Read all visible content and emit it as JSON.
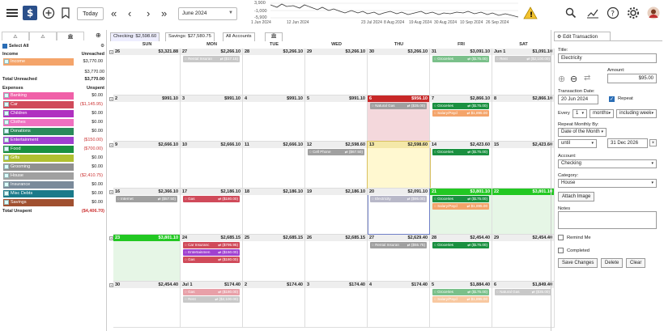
{
  "toolbar": {
    "today_label": "Today",
    "month_value": "June 2024",
    "sparkline": {
      "y_labels": [
        "3,900",
        "-1,000",
        "-5,900"
      ],
      "x_labels": [
        "1 Jun 2024",
        "12 Jun 2024",
        "23 Jul 2024",
        "8 Aug 2024",
        "19 Aug 2024",
        "30 Aug 2024",
        "10 Sep 2024",
        "26 Sep 2024"
      ]
    }
  },
  "sidebar": {
    "select_all": "Select All",
    "income_header": "Income",
    "unreached_header": "Unreached",
    "income": [
      {
        "label": "Income",
        "amount": "$3,770.00",
        "color": "#f4a46a"
      }
    ],
    "income_amount2": "$3,770.00",
    "total_unreached_label": "Total Unreached",
    "total_unreached": "$3,770.00",
    "expenses_header": "Expenses",
    "unspent_header": "Unspent",
    "expenses": [
      {
        "label": "Banking",
        "amount": "$0.00",
        "color": "#f060a8",
        "neg": false
      },
      {
        "label": "Car",
        "amount": "($1,145.95)",
        "color": "#d04a5a",
        "neg": true
      },
      {
        "label": "Children",
        "amount": "$0.00",
        "color": "#b030c0",
        "neg": false
      },
      {
        "label": "Clothes",
        "amount": "$0.00",
        "color": "#f070c0",
        "neg": false
      },
      {
        "label": "Donations",
        "amount": "$0.00",
        "color": "#2a8a5a",
        "neg": false
      },
      {
        "label": "Entertainment",
        "amount": "($150.00)",
        "color": "#a040d0",
        "neg": true
      },
      {
        "label": "Food",
        "amount": "($700.00)",
        "color": "#1a9040",
        "neg": true
      },
      {
        "label": "Gifts",
        "amount": "$0.00",
        "color": "#b0c030",
        "neg": false
      },
      {
        "label": "Grooming",
        "amount": "$0.00",
        "color": "#909090",
        "neg": false
      },
      {
        "label": "House",
        "amount": "($2,410.75)",
        "color": "#a0a0a0",
        "neg": true
      },
      {
        "label": "Insurance",
        "amount": "$0.00",
        "color": "#7a8a9a",
        "neg": false
      },
      {
        "label": "Misc Debts",
        "amount": "$0.00",
        "color": "#1a7a8a",
        "neg": false
      },
      {
        "label": "Savings",
        "amount": "$0.00",
        "color": "#a05030",
        "neg": false
      }
    ],
    "total_unspent_label": "Total Unspent",
    "total_unspent": "($4,406.70)"
  },
  "main": {
    "tabs": [
      "Checking: $2,598.60",
      "Savings: $27,580.75",
      "All Accounts"
    ],
    "days": [
      "SUN",
      "MON",
      "TUE",
      "WED",
      "THU",
      "FRI",
      "SAT"
    ],
    "weeks": [
      [
        {
          "d": "26",
          "bal": "$3,321.88",
          "ev": []
        },
        {
          "d": "27",
          "bal": "$2,266.10",
          "ev": [
            {
              "t": "Rental Insuran",
              "a": "⇄ ($17.15)",
              "c": "#c8c8c8"
            }
          ]
        },
        {
          "d": "28",
          "bal": "$3,266.10",
          "ev": []
        },
        {
          "d": "29",
          "bal": "$3,266.10",
          "ev": []
        },
        {
          "d": "30",
          "bal": "$3,266.10",
          "ev": []
        },
        {
          "d": "31",
          "bal": "$3,091.10",
          "ev": [
            {
              "t": "Groceries",
              "a": "⇄ ($175.00)",
              "c": "#7ac08a"
            }
          ]
        },
        {
          "d": "Jun 1",
          "bal": "$1,091.10",
          "ev": [
            {
              "t": "Rent",
              "a": "⇄ ($2,100.00)",
              "c": "#c8c8c8"
            }
          ]
        }
      ],
      [
        {
          "d": "2",
          "bal": "$991.10",
          "ev": []
        },
        {
          "d": "3",
          "bal": "$991.10",
          "ev": []
        },
        {
          "d": "4",
          "bal": "$991.10",
          "ev": []
        },
        {
          "d": "5",
          "bal": "$991.10",
          "ev": []
        },
        {
          "d": "6",
          "bal": "$956.10",
          "ev": [
            {
              "t": "Natural Gas",
              "a": "⇄ ($35.00)",
              "c": "#a0a0a0"
            }
          ],
          "red": true
        },
        {
          "d": "7",
          "bal": "$2,866.10",
          "ev": [
            {
              "t": "Groceries",
              "a": "⇄ ($175.00)",
              "c": "#1a9040"
            },
            {
              "t": "Salary/Payd",
              "a": "⇄ $1,895.00",
              "c": "#f4a46a"
            }
          ]
        },
        {
          "d": "8",
          "bal": "$2,866.10",
          "ev": []
        }
      ],
      [
        {
          "d": "9",
          "bal": "$2,666.10",
          "ev": []
        },
        {
          "d": "10",
          "bal": "$2,666.10",
          "ev": []
        },
        {
          "d": "11",
          "bal": "$2,666.10",
          "ev": []
        },
        {
          "d": "12",
          "bal": "$2,598.60",
          "ev": [
            {
              "t": "Cell Phone",
              "a": "⇄ ($67.50)",
              "c": "#a0a0a0"
            }
          ]
        },
        {
          "d": "13",
          "bal": "$2,598.60",
          "ev": [],
          "today": true
        },
        {
          "d": "14",
          "bal": "$2,423.60",
          "ev": [
            {
              "t": "Groceries",
              "a": "⇄ ($175.00)",
              "c": "#1a9040"
            }
          ]
        },
        {
          "d": "15",
          "bal": "$2,423.60",
          "ev": []
        }
      ],
      [
        {
          "d": "16",
          "bal": "$2,366.10",
          "ev": [
            {
              "t": "Internet",
              "a": "⇄ ($57.50)",
              "c": "#a0a0a0"
            }
          ]
        },
        {
          "d": "17",
          "bal": "$2,186.10",
          "ev": [
            {
              "t": "Gas",
              "a": "⇄ ($180.00)",
              "c": "#d04a5a"
            }
          ]
        },
        {
          "d": "18",
          "bal": "$2,186.10",
          "ev": []
        },
        {
          "d": "19",
          "bal": "$2,186.10",
          "ev": []
        },
        {
          "d": "20",
          "bal": "$2,091.10",
          "ev": [
            {
              "t": "Electricity",
              "a": "⇄ ($95.00)",
              "c": "#b8b8c8"
            }
          ],
          "sel": true
        },
        {
          "d": "21",
          "bal": "$3,801.10",
          "ev": [
            {
              "t": "Groceries",
              "a": "⇄ ($175.00)",
              "c": "#1a9040"
            },
            {
              "t": "Salary/Payd",
              "a": "⇄ $1,895.00",
              "c": "#f4a46a"
            }
          ],
          "green": true
        },
        {
          "d": "22",
          "bal": "$3,801.10",
          "ev": [],
          "green": true
        }
      ],
      [
        {
          "d": "23",
          "bal": "$3,801.10",
          "ev": [],
          "green": true
        },
        {
          "d": "24",
          "bal": "$2,685.15",
          "ev": [
            {
              "t": "Car Insuranc",
              "a": "⇄ ($795.95)",
              "c": "#d04a5a"
            },
            {
              "t": "Entertainmen",
              "a": "⇄ ($150.00)",
              "c": "#a040d0"
            },
            {
              "t": "Gas",
              "a": "⇄ ($180.00)",
              "c": "#d04a5a"
            }
          ]
        },
        {
          "d": "25",
          "bal": "$2,685.15",
          "ev": []
        },
        {
          "d": "26",
          "bal": "$2,685.15",
          "ev": []
        },
        {
          "d": "27",
          "bal": "$2,629.40",
          "ev": [
            {
              "t": "Rental Insuran",
              "a": "⇄ ($55.75)",
              "c": "#a0a0a0"
            }
          ]
        },
        {
          "d": "28",
          "bal": "$2,454.40",
          "ev": [
            {
              "t": "Groceries",
              "a": "⇄ ($175.00)",
              "c": "#1a9040"
            }
          ]
        },
        {
          "d": "29",
          "bal": "$2,454.40",
          "ev": []
        }
      ],
      [
        {
          "d": "30",
          "bal": "$2,454.40",
          "ev": []
        },
        {
          "d": "Jul 1",
          "bal": "$174.40",
          "ev": [
            {
              "t": "Gas",
              "a": "⇄ ($180.00)",
              "c": "#e8a0a8"
            },
            {
              "t": "Rent",
              "a": "⇄ ($2,100.00)",
              "c": "#c8c8c8"
            }
          ]
        },
        {
          "d": "2",
          "bal": "$174.40",
          "ev": []
        },
        {
          "d": "3",
          "bal": "$174.40",
          "ev": []
        },
        {
          "d": "4",
          "bal": "$174.40",
          "ev": []
        },
        {
          "d": "5",
          "bal": "$1,884.40",
          "ev": [
            {
              "t": "Groceries",
              "a": "⇄ ($175.00)",
              "c": "#7ac08a"
            },
            {
              "t": "Salary/Payd",
              "a": "⇄ $1,895.00",
              "c": "#f8c8a0"
            }
          ]
        },
        {
          "d": "6",
          "bal": "$1,849.40",
          "ev": [
            {
              "t": "Natural Gas",
              "a": "⇄ ($35.00)",
              "c": "#c8c8c8"
            }
          ]
        }
      ]
    ]
  },
  "panel": {
    "tab_label": "Edit Transaction",
    "title_label": "Title:",
    "title_value": "Electricity",
    "amount_label": "Amount:",
    "amount_value": "$95.00",
    "date_label": "Transaction Date:",
    "date_value": "20 Jun 2024",
    "repeat_label": "Repeat",
    "every_label": "Every",
    "every_n": "1",
    "every_unit": "months",
    "including": "including week",
    "repeat_by_label": "Repeat Monthly By:",
    "repeat_by_value": "Date of the Month",
    "until_label": "until",
    "until_date": "31 Dec 2026",
    "account_label": "Account:",
    "account_value": "Checking",
    "category_label": "Category:",
    "category_value": "House",
    "attach_label": "Attach Image",
    "notes_label": "Notes",
    "remind_label": "Remind Me",
    "completed_label": "Completed",
    "save_label": "Save Changes",
    "delete_label": "Delete",
    "clear_label": "Clear"
  }
}
